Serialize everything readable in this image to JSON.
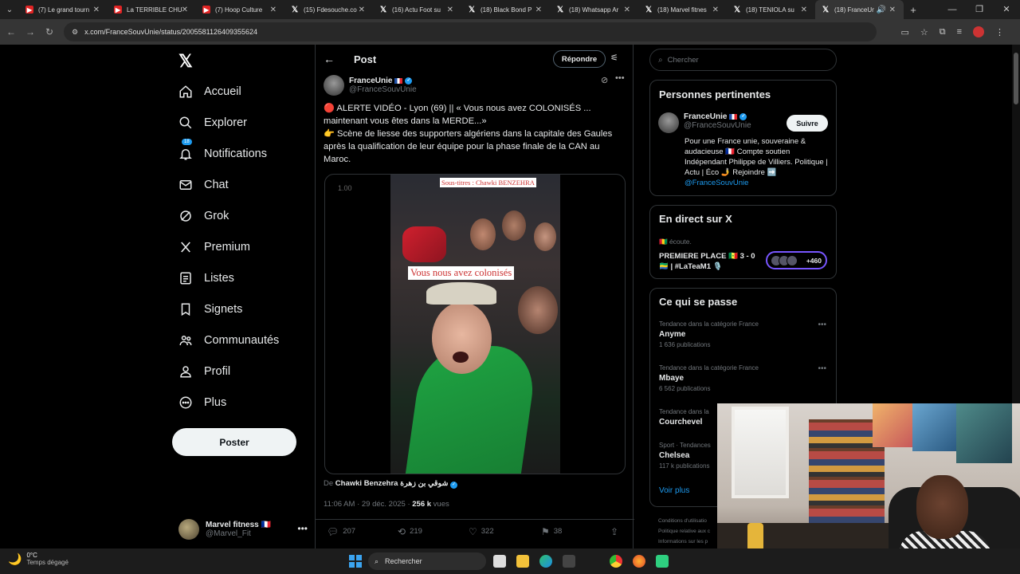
{
  "browser": {
    "tabs": [
      {
        "label": "(7) Le grand tourn",
        "favicon": "youtube-icon"
      },
      {
        "label": "La TERRIBLE CHU",
        "favicon": "youtube-icon"
      },
      {
        "label": "(7) Hoop Culture",
        "favicon": "youtube-icon"
      },
      {
        "label": "(15) Fdesouche.co",
        "favicon": "x-icon"
      },
      {
        "label": "(16) Actu Foot su",
        "favicon": "x-icon"
      },
      {
        "label": "(18) Black Bond P",
        "favicon": "x-icon"
      },
      {
        "label": "(18) Whatsapp Ar",
        "favicon": "x-icon"
      },
      {
        "label": "(18) Marvel fitnes",
        "favicon": "x-icon"
      },
      {
        "label": "(18) TENIOLA su",
        "favicon": "x-icon"
      },
      {
        "label": "(18) FranceUn",
        "favicon": "x-icon"
      }
    ],
    "url": "x.com/FranceSouvUnie/status/2005581126409355624"
  },
  "nav": {
    "items": [
      {
        "label": "Accueil",
        "icon": "home-icon"
      },
      {
        "label": "Explorer",
        "icon": "search-icon"
      },
      {
        "label": "Notifications",
        "icon": "bell-icon",
        "badge": "18"
      },
      {
        "label": "Chat",
        "icon": "mail-icon"
      },
      {
        "label": "Grok",
        "icon": "grok-icon"
      },
      {
        "label": "Premium",
        "icon": "x-icon"
      },
      {
        "label": "Listes",
        "icon": "list-icon"
      },
      {
        "label": "Signets",
        "icon": "bookmark-icon"
      },
      {
        "label": "Communautés",
        "icon": "communities-icon"
      },
      {
        "label": "Profil",
        "icon": "person-icon"
      },
      {
        "label": "Plus",
        "icon": "more-circle-icon"
      }
    ],
    "post_button": "Poster",
    "account": {
      "name": "Marvel fitness 🇫🇷",
      "handle": "@Marvel_Fit"
    }
  },
  "post": {
    "header_title": "Post",
    "reply_button": "Répondre",
    "author": {
      "name": "FranceUnie",
      "handle": "@FranceSouvUnie"
    },
    "text_lines": [
      "🔴 ALERTE VIDÉO - Lyon (69)  || « Vous nous avez COLONISÉS ...",
      "maintenant vous êtes dans la MERDE...»",
      "👉 Scène de liesse des supporters algériens dans la capitale des Gaules",
      "après la qualification de leur équipe pour la phase finale de la CAN au",
      "Maroc."
    ],
    "video": {
      "speed": "1.00",
      "subtitle_credit": "Sous-titres : Chawki BENZEHRA",
      "caption": "Vous nous avez colonisés"
    },
    "from_label": "De",
    "from_name": "Chawki Benzehra شوقي بن زهرة",
    "time": "11:06 AM · 29 déc. 2025 · ",
    "views": "256 k",
    "views_label": " vues",
    "actions": {
      "replies": "207",
      "reposts": "219",
      "likes": "322",
      "bookmarks": "38"
    }
  },
  "sidebar": {
    "search_placeholder": "Chercher",
    "relevant": {
      "title": "Personnes pertinentes",
      "name": "FranceUnie",
      "handle": "@FranceSouvUnie",
      "follow_button": "Suivre",
      "bio": "Pour une France unie, souveraine & audacieuse 🇫🇷 Compte soutien Indépendant Philippe de Villiers. Politique | Actu | Éco 🤳 Rejoindre ➡️",
      "bio_link": "@FranceSouvUnie"
    },
    "live": {
      "title": "En direct sur X",
      "subtitle": "🇬🇳 écoute.",
      "space_title": "PREMIERE PLACE 🇸🇳 3 - 0 🇬🇦 | #LaTeaM1 🎙️",
      "listeners": "+460"
    },
    "trends": {
      "title": "Ce qui se passe",
      "items": [
        {
          "category": "Tendance dans la catégorie France",
          "topic": "Anyme",
          "count": "1 636 publications"
        },
        {
          "category": "Tendance dans la catégorie France",
          "topic": "Mbaye",
          "count": "6 562 publications"
        },
        {
          "category": "Tendance dans la",
          "topic": "Courchevel",
          "count": ""
        },
        {
          "category": "Sport · Tendances",
          "topic": "Chelsea",
          "count": "117 k publications"
        }
      ],
      "see_all": "Voir plus"
    },
    "footer": [
      "Conditions d'utilisatio",
      "Politique relative aux c",
      "Informations sur les p"
    ]
  },
  "taskbar": {
    "temperature": "0°C",
    "weather": "Temps dégagé",
    "search": "Rechercher"
  }
}
